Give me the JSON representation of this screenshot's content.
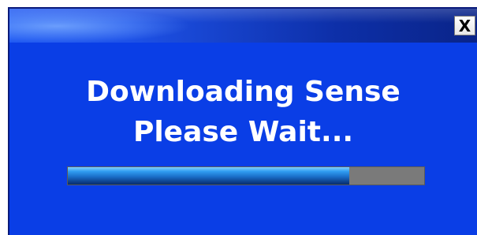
{
  "window": {
    "close_label": "X"
  },
  "message": {
    "line1": "Downloading Sense",
    "line2": "Please Wait..."
  },
  "progress": {
    "fraction": 0.79
  },
  "colors": {
    "window_background": "#0a3ee6",
    "titlebar": "#1e52e8",
    "text": "#ffffff",
    "progress_track": "#7a7a7a",
    "progress_fill": "#1a6ec8"
  }
}
